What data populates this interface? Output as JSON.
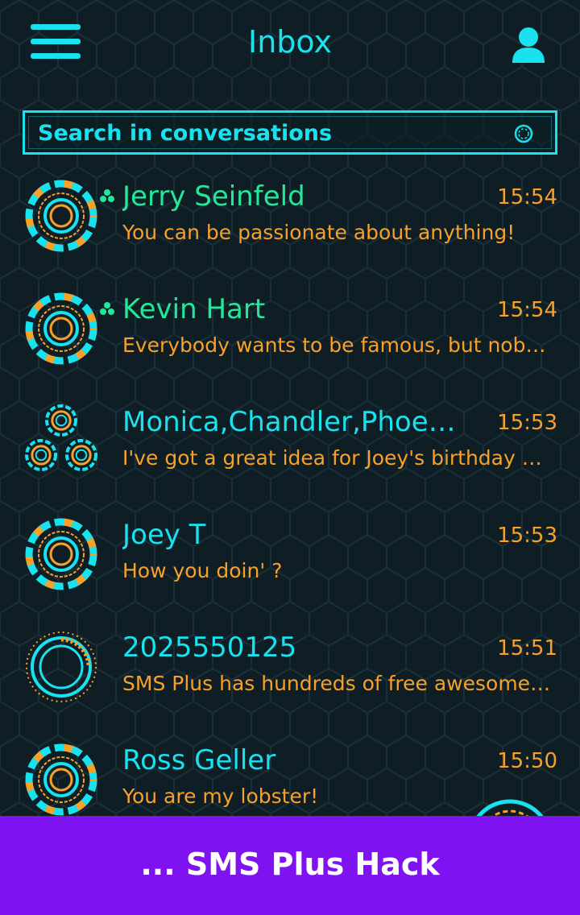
{
  "header": {
    "title": "Inbox",
    "menu_icon": "hamburger-icon",
    "profile_icon": "user-icon"
  },
  "search": {
    "placeholder": "Search in conversations",
    "value": "",
    "icon": "search-icon"
  },
  "conversations": [
    {
      "name": "Jerry Seinfeld",
      "time": "15:54",
      "preview": "You can be passionate about anything!",
      "online": true,
      "avatar": "contact-avatar"
    },
    {
      "name": "Kevin Hart",
      "time": "15:54",
      "preview": "Everybody wants to be famous, but nobody wants to do the work.",
      "online": true,
      "avatar": "contact-avatar"
    },
    {
      "name": "Monica,Chandler,Phoebe,Ross",
      "time": "15:53",
      "preview": "I've got a great idea for Joey's birthday party!",
      "online": false,
      "avatar": "group-avatar"
    },
    {
      "name": "Joey T",
      "time": "15:53",
      "preview": "How you doin' ?",
      "online": false,
      "avatar": "contact-avatar"
    },
    {
      "name": "2025550125",
      "time": "15:51",
      "preview": "SMS Plus has hundreds of free awesome themes!",
      "online": false,
      "avatar": "unknown-number-avatar"
    },
    {
      "name": "Ross Geller",
      "time": "15:50",
      "preview": "You are my lobster!",
      "online": false,
      "avatar": "contact-avatar"
    }
  ],
  "banner": {
    "text": "... SMS Plus Hack"
  },
  "colors": {
    "accent": "#19e1ee",
    "online": "#22e89a",
    "secondary": "#f7a12a",
    "background": "#0e1e24",
    "banner": "#7f12f0"
  }
}
